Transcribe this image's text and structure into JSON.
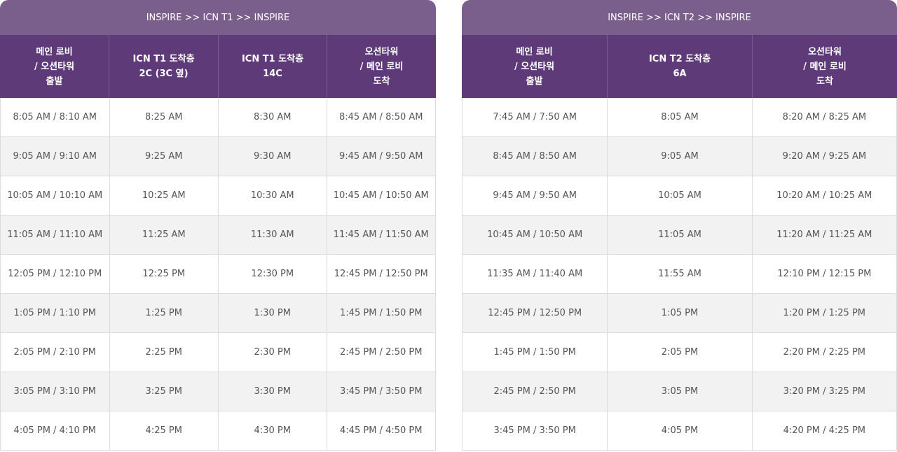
{
  "tables": [
    {
      "title": "INSPIRE >> ICN T1 >> INSPIRE",
      "columns": [
        "메인 로비\n/ 오션타워\n출발",
        "ICN T1 도착층\n2C (3C 옆)",
        "ICN T1 도착층\n14C",
        "오션타워\n/ 메인 로비\n도착"
      ],
      "rows": [
        [
          "8:05 AM / 8:10 AM",
          "8:25 AM",
          "8:30 AM",
          "8:45 AM / 8:50 AM"
        ],
        [
          "9:05 AM / 9:10 AM",
          "9:25 AM",
          "9:30 AM",
          "9:45 AM / 9:50 AM"
        ],
        [
          "10:05 AM / 10:10 AM",
          "10:25 AM",
          "10:30 AM",
          "10:45 AM / 10:50 AM"
        ],
        [
          "11:05 AM / 11:10 AM",
          "11:25 AM",
          "11:30 AM",
          "11:45 AM / 11:50 AM"
        ],
        [
          "12:05 PM / 12:10 PM",
          "12:25 PM",
          "12:30 PM",
          "12:45 PM / 12:50 PM"
        ],
        [
          "1:05 PM / 1:10 PM",
          "1:25 PM",
          "1:30 PM",
          "1:45 PM / 1:50 PM"
        ],
        [
          "2:05 PM / 2:10 PM",
          "2:25 PM",
          "2:30 PM",
          "2:45 PM / 2:50 PM"
        ],
        [
          "3:05 PM / 3:10 PM",
          "3:25 PM",
          "3:30 PM",
          "3:45 PM / 3:50 PM"
        ],
        [
          "4:05 PM / 4:10 PM",
          "4:25 PM",
          "4:30 PM",
          "4:45 PM / 4:50 PM"
        ]
      ]
    },
    {
      "title": "INSPIRE >> ICN T2 >> INSPIRE",
      "columns": [
        "메인 로비\n/ 오션타워\n출발",
        "ICN T2 도착층\n6A",
        "오션타워\n/ 메인 로비\n도착"
      ],
      "rows": [
        [
          "7:45 AM / 7:50 AM",
          "8:05 AM",
          "8:20 AM / 8:25 AM"
        ],
        [
          "8:45 AM / 8:50 AM",
          "9:05 AM",
          "9:20 AM / 9:25 AM"
        ],
        [
          "9:45 AM / 9:50 AM",
          "10:05 AM",
          "10:20 AM / 10:25 AM"
        ],
        [
          "10:45 AM / 10:50 AM",
          "11:05 AM",
          "11:20 AM / 11:25 AM"
        ],
        [
          "11:35 AM / 11:40 AM",
          "11:55 AM",
          "12:10 PM / 12:15 PM"
        ],
        [
          "12:45 PM / 12:50 PM",
          "1:05 PM",
          "1:20 PM / 1:25 PM"
        ],
        [
          "1:45 PM / 1:50 PM",
          "2:05 PM",
          "2:20 PM / 2:25 PM"
        ],
        [
          "2:45 PM / 2:50 PM",
          "3:05 PM",
          "3:20 PM / 3:25 PM"
        ],
        [
          "3:45 PM / 3:50 PM",
          "4:05 PM",
          "4:20 PM / 4:25 PM"
        ]
      ]
    }
  ],
  "colors": {
    "title_bar": "#7a5e8b",
    "header_bar": "#5e3a78",
    "row_alt": "#f2f2f2",
    "text": "#555555"
  }
}
